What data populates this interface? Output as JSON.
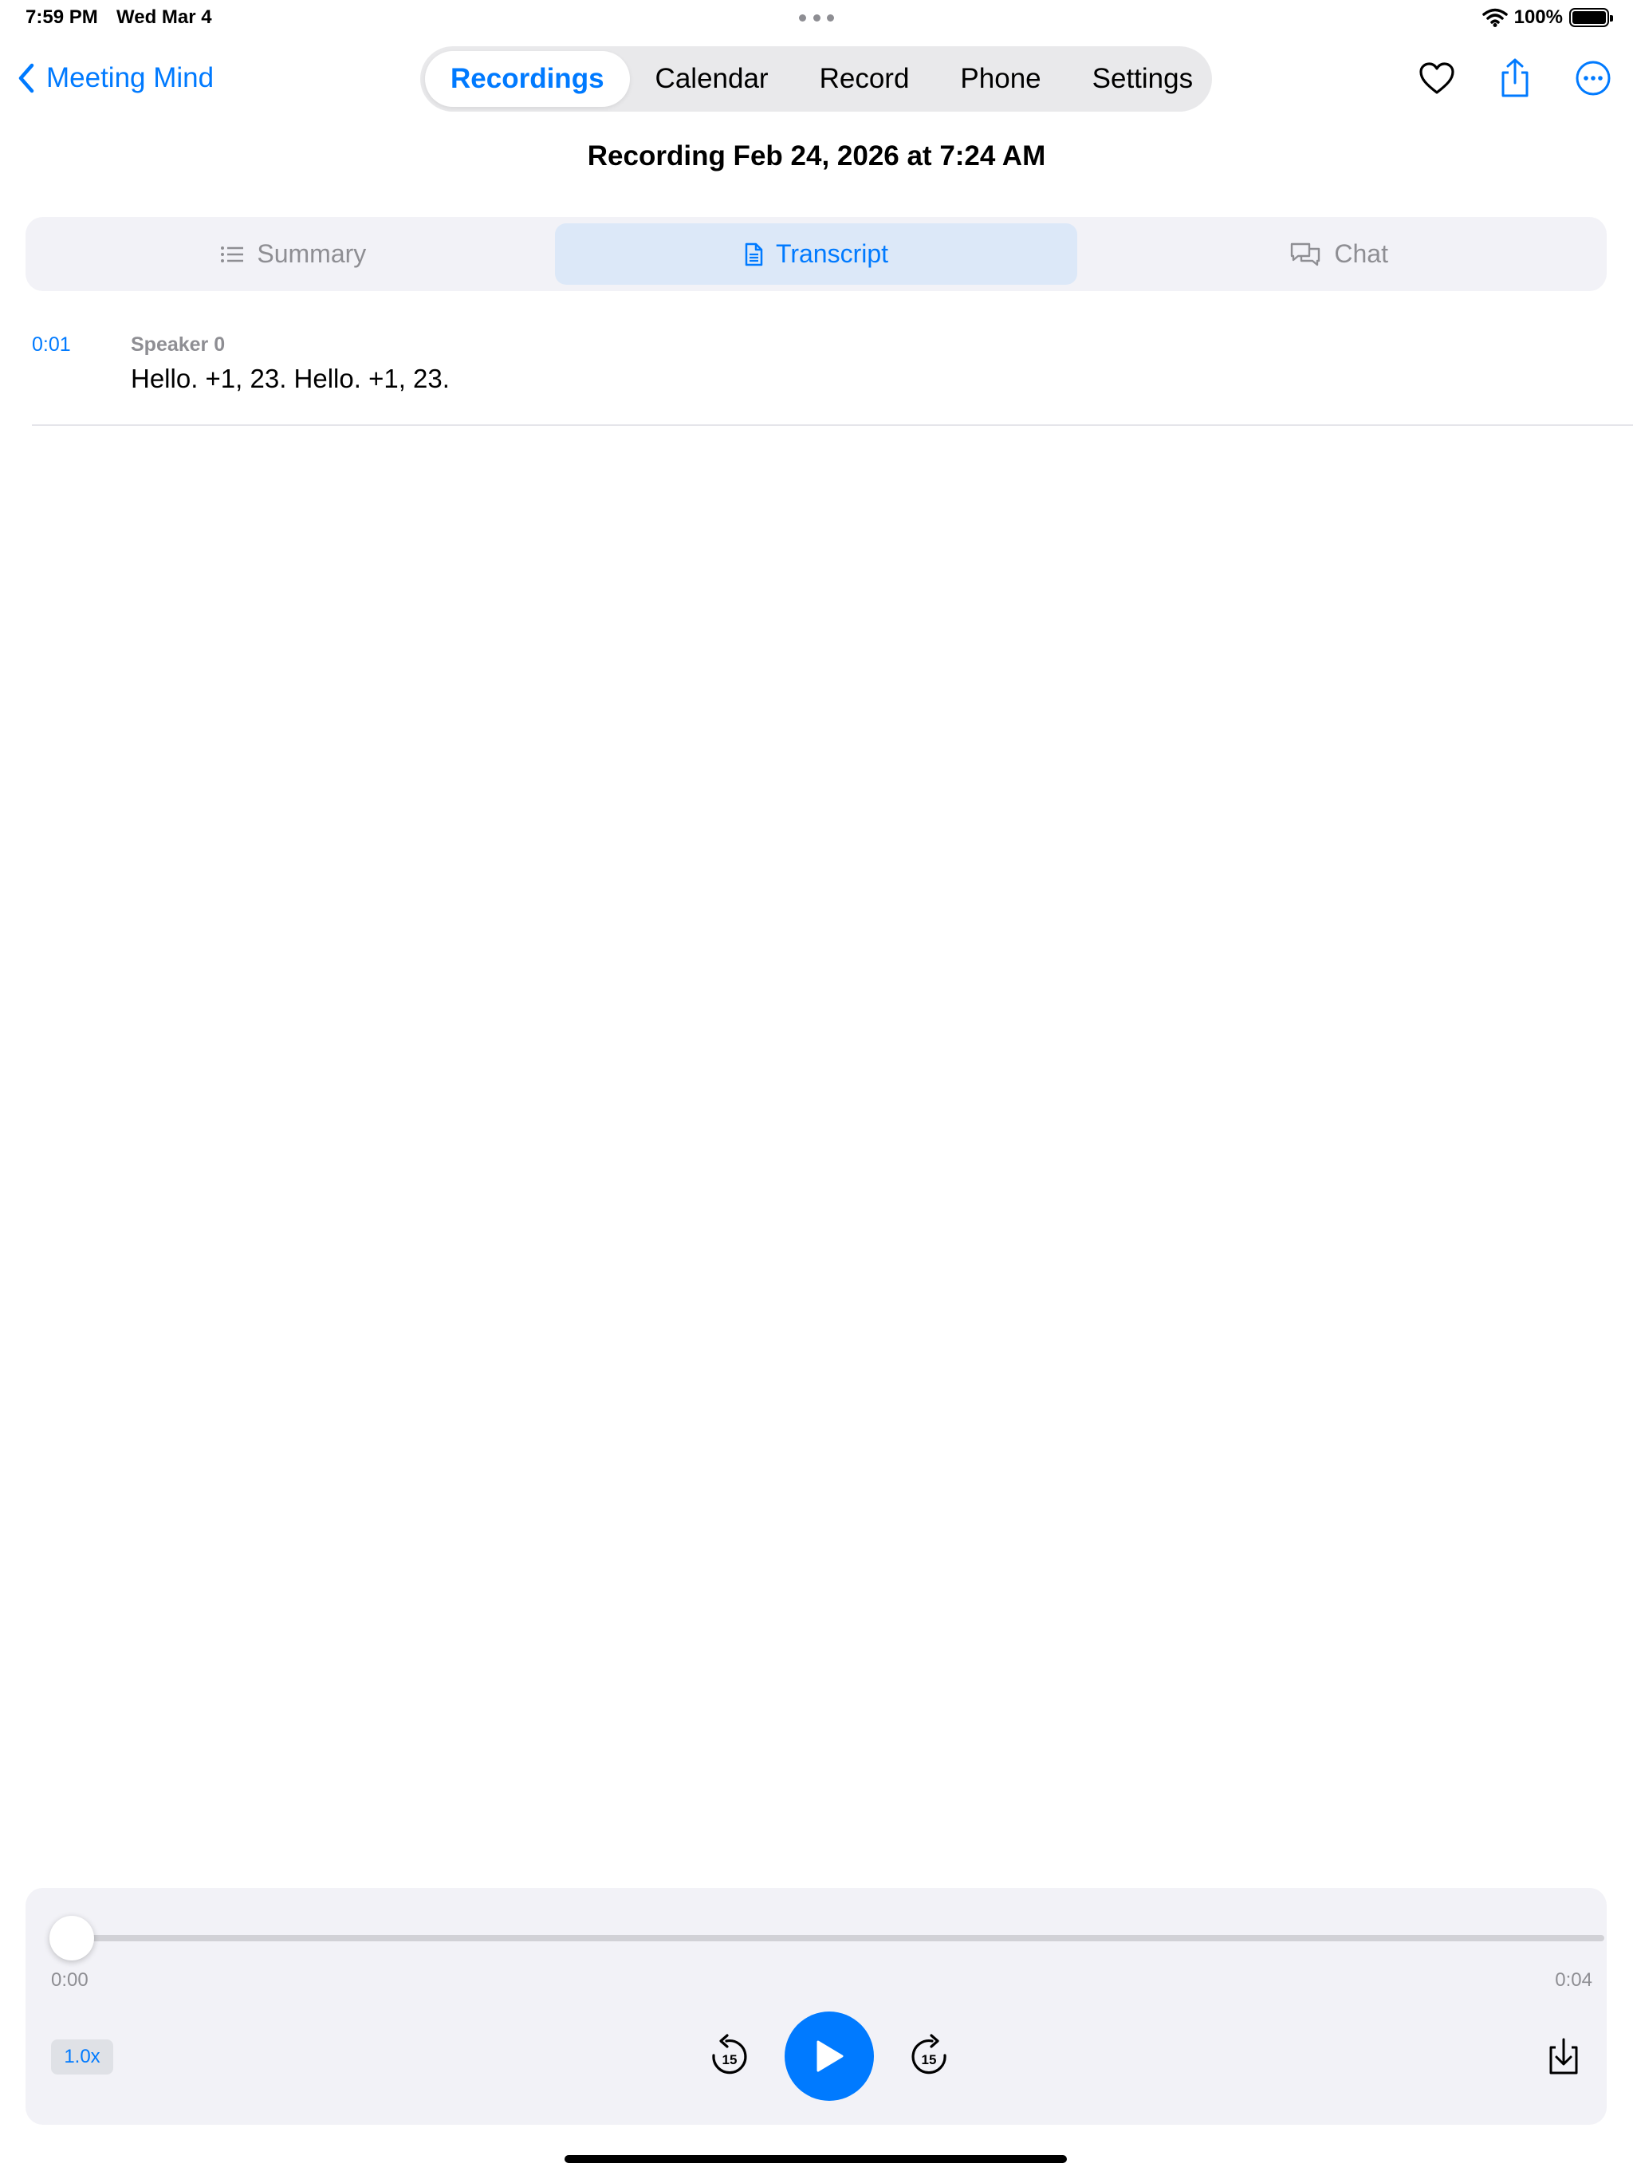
{
  "status_bar": {
    "time": "7:59 PM",
    "date": "Wed Mar 4",
    "battery_percent": "100%",
    "battery_level": 1.0
  },
  "nav": {
    "back_label": "Meeting Mind",
    "segments": [
      "Recordings",
      "Calendar",
      "Record",
      "Phone",
      "Settings"
    ],
    "active_segment": "Recordings",
    "actions": [
      "heart-icon",
      "share-icon",
      "more-icon"
    ]
  },
  "page": {
    "title": "Recording Feb 24, 2026 at 7:24 AM"
  },
  "tabs": {
    "items": [
      {
        "label": "Summary",
        "icon": "list-icon"
      },
      {
        "label": "Transcript",
        "icon": "document-icon"
      },
      {
        "label": "Chat",
        "icon": "chat-bubbles-icon"
      }
    ],
    "active": "Transcript"
  },
  "transcript": {
    "segments": [
      {
        "time": "0:01",
        "speaker": "Speaker 0",
        "text": "Hello. +1, 23. Hello. +1, 23."
      }
    ]
  },
  "player": {
    "current_time": "0:00",
    "duration": "0:04",
    "progress": 0.0,
    "speed": "1.0x",
    "skip_back_seconds": "15",
    "skip_forward_seconds": "15"
  },
  "colors": {
    "accent": "#007aff",
    "secondary_text": "#8e8e93",
    "panel_background": "#f2f2f7",
    "active_tab_background": "#dce8f8"
  }
}
